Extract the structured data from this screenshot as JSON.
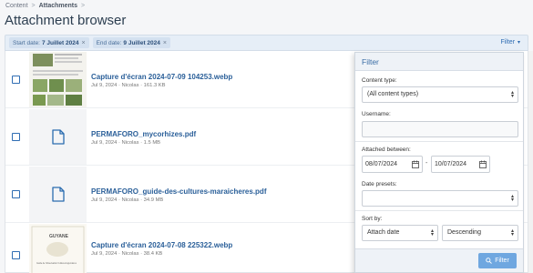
{
  "breadcrumb": {
    "content": "Content",
    "attachments": "Attachments",
    "sep": ">"
  },
  "title": "Attachment browser",
  "filter_bar": {
    "chips": [
      {
        "label": "Start date:",
        "value": "7 Juillet 2024",
        "remove": "×"
      },
      {
        "label": "End date:",
        "value": "9 Juillet 2024",
        "remove": "×"
      }
    ],
    "toggle_label": "Filter",
    "toggle_caret": "▾"
  },
  "attachments": [
    {
      "name": "Capture d'écran 2024-07-09 104253.webp",
      "meta": "Jul 9, 2024 · Nicolas · 161.3 KB",
      "thumb": "image"
    },
    {
      "name": "PERMAFORO_mycorhizes.pdf",
      "meta": "Jul 9, 2024 · Nicolas · 1.5 MB",
      "thumb": "file-icon"
    },
    {
      "name": "PERMAFORO_guide-des-cultures-maraicheres.pdf",
      "meta": "Jul 9, 2024 · Nicolas · 34.9 MB",
      "thumb": "file-icon"
    },
    {
      "name": "Capture d'écran 2024-07-08 225322.webp",
      "meta": "Jul 9, 2024 · Nicolas · 38.4 KB",
      "thumb": "image"
    }
  ],
  "panel": {
    "title": "Filter",
    "content_type_label": "Content type:",
    "content_type_value": "(All content types)",
    "username_label": "Username:",
    "username_value": "",
    "attached_between_label": "Attached between:",
    "date_from": "08/07/2024",
    "date_to": "10/07/2024",
    "date_dash": "-",
    "date_presets_label": "Date presets:",
    "date_presets_value": "",
    "sort_by_label": "Sort by:",
    "sort_field": "Attach date",
    "sort_order": "Descending",
    "submit": "Filter"
  },
  "thumb_texts": {
    "guyane": "GUYANE",
    "guide": "Guide de l'observation Cultures légumières"
  }
}
